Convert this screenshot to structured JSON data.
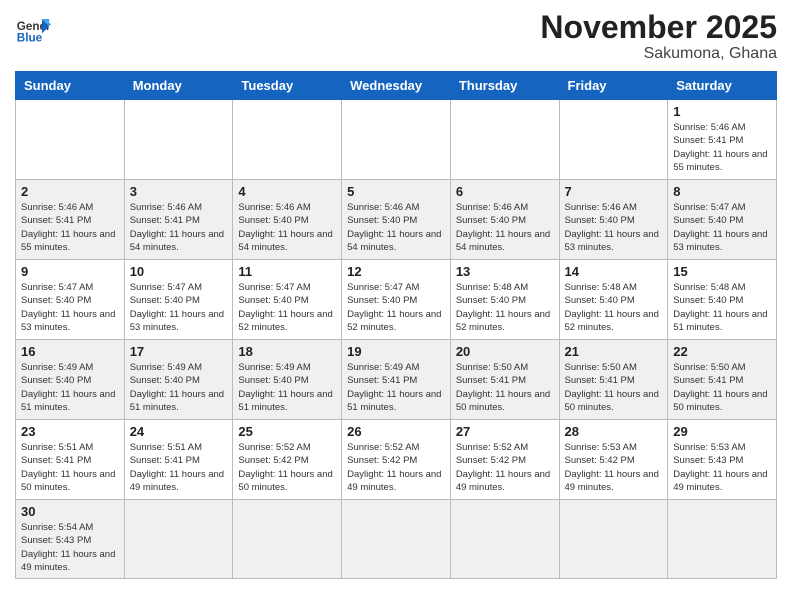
{
  "header": {
    "logo_general": "General",
    "logo_blue": "Blue",
    "month_title": "November 2025",
    "location": "Sakumona, Ghana"
  },
  "weekdays": [
    "Sunday",
    "Monday",
    "Tuesday",
    "Wednesday",
    "Thursday",
    "Friday",
    "Saturday"
  ],
  "days": [
    {
      "number": "1",
      "sunrise": "5:46 AM",
      "sunset": "5:41 PM",
      "daylight": "11 hours and 55 minutes."
    },
    {
      "number": "2",
      "sunrise": "5:46 AM",
      "sunset": "5:41 PM",
      "daylight": "11 hours and 55 minutes."
    },
    {
      "number": "3",
      "sunrise": "5:46 AM",
      "sunset": "5:41 PM",
      "daylight": "11 hours and 54 minutes."
    },
    {
      "number": "4",
      "sunrise": "5:46 AM",
      "sunset": "5:40 PM",
      "daylight": "11 hours and 54 minutes."
    },
    {
      "number": "5",
      "sunrise": "5:46 AM",
      "sunset": "5:40 PM",
      "daylight": "11 hours and 54 minutes."
    },
    {
      "number": "6",
      "sunrise": "5:46 AM",
      "sunset": "5:40 PM",
      "daylight": "11 hours and 54 minutes."
    },
    {
      "number": "7",
      "sunrise": "5:46 AM",
      "sunset": "5:40 PM",
      "daylight": "11 hours and 53 minutes."
    },
    {
      "number": "8",
      "sunrise": "5:47 AM",
      "sunset": "5:40 PM",
      "daylight": "11 hours and 53 minutes."
    },
    {
      "number": "9",
      "sunrise": "5:47 AM",
      "sunset": "5:40 PM",
      "daylight": "11 hours and 53 minutes."
    },
    {
      "number": "10",
      "sunrise": "5:47 AM",
      "sunset": "5:40 PM",
      "daylight": "11 hours and 53 minutes."
    },
    {
      "number": "11",
      "sunrise": "5:47 AM",
      "sunset": "5:40 PM",
      "daylight": "11 hours and 52 minutes."
    },
    {
      "number": "12",
      "sunrise": "5:47 AM",
      "sunset": "5:40 PM",
      "daylight": "11 hours and 52 minutes."
    },
    {
      "number": "13",
      "sunrise": "5:48 AM",
      "sunset": "5:40 PM",
      "daylight": "11 hours and 52 minutes."
    },
    {
      "number": "14",
      "sunrise": "5:48 AM",
      "sunset": "5:40 PM",
      "daylight": "11 hours and 52 minutes."
    },
    {
      "number": "15",
      "sunrise": "5:48 AM",
      "sunset": "5:40 PM",
      "daylight": "11 hours and 51 minutes."
    },
    {
      "number": "16",
      "sunrise": "5:49 AM",
      "sunset": "5:40 PM",
      "daylight": "11 hours and 51 minutes."
    },
    {
      "number": "17",
      "sunrise": "5:49 AM",
      "sunset": "5:40 PM",
      "daylight": "11 hours and 51 minutes."
    },
    {
      "number": "18",
      "sunrise": "5:49 AM",
      "sunset": "5:40 PM",
      "daylight": "11 hours and 51 minutes."
    },
    {
      "number": "19",
      "sunrise": "5:49 AM",
      "sunset": "5:41 PM",
      "daylight": "11 hours and 51 minutes."
    },
    {
      "number": "20",
      "sunrise": "5:50 AM",
      "sunset": "5:41 PM",
      "daylight": "11 hours and 50 minutes."
    },
    {
      "number": "21",
      "sunrise": "5:50 AM",
      "sunset": "5:41 PM",
      "daylight": "11 hours and 50 minutes."
    },
    {
      "number": "22",
      "sunrise": "5:50 AM",
      "sunset": "5:41 PM",
      "daylight": "11 hours and 50 minutes."
    },
    {
      "number": "23",
      "sunrise": "5:51 AM",
      "sunset": "5:41 PM",
      "daylight": "11 hours and 50 minutes."
    },
    {
      "number": "24",
      "sunrise": "5:51 AM",
      "sunset": "5:41 PM",
      "daylight": "11 hours and 49 minutes."
    },
    {
      "number": "25",
      "sunrise": "5:52 AM",
      "sunset": "5:42 PM",
      "daylight": "11 hours and 50 minutes."
    },
    {
      "number": "26",
      "sunrise": "5:52 AM",
      "sunset": "5:42 PM",
      "daylight": "11 hours and 49 minutes."
    },
    {
      "number": "27",
      "sunrise": "5:52 AM",
      "sunset": "5:42 PM",
      "daylight": "11 hours and 49 minutes."
    },
    {
      "number": "28",
      "sunrise": "5:53 AM",
      "sunset": "5:42 PM",
      "daylight": "11 hours and 49 minutes."
    },
    {
      "number": "29",
      "sunrise": "5:53 AM",
      "sunset": "5:43 PM",
      "daylight": "11 hours and 49 minutes."
    },
    {
      "number": "30",
      "sunrise": "5:54 AM",
      "sunset": "5:43 PM",
      "daylight": "11 hours and 49 minutes."
    }
  ],
  "labels": {
    "sunrise": "Sunrise:",
    "sunset": "Sunset:",
    "daylight": "Daylight:"
  }
}
